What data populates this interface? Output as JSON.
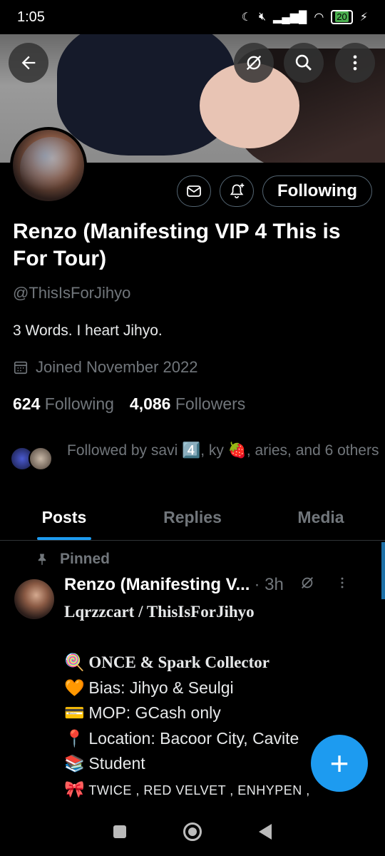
{
  "status_bar": {
    "time": "1:05",
    "battery": "20",
    "icons": [
      "moon-icon",
      "muted-icon",
      "signal-icon",
      "wifi-icon",
      "battery-icon",
      "charging-icon"
    ]
  },
  "header": {
    "back_icon": "back-arrow-icon",
    "grok_icon": "grok-icon",
    "search_icon": "search-icon",
    "more_icon": "more-vertical-icon"
  },
  "profile": {
    "display_name": "Renzo (Manifesting VIP 4 This is For Tour)",
    "handle": "@ThisIsForJihyo",
    "bio": "3 Words. I heart Jihyo.",
    "joined": "Joined November 2022",
    "following_count": "624",
    "following_label": "Following",
    "followers_count": "4,086",
    "followers_label": "Followers",
    "followed_by": "Followed by savi 4️⃣, ky 🍓, aries, and 6 others"
  },
  "actions": {
    "message_icon": "envelope-icon",
    "notify_icon": "bell-plus-icon",
    "following_button": "Following"
  },
  "tabs": [
    {
      "label": "Posts",
      "active": true
    },
    {
      "label": "Replies",
      "active": false
    },
    {
      "label": "Media",
      "active": false
    }
  ],
  "post": {
    "pinned_label": "Pinned",
    "author": "Renzo (Manifesting V...",
    "time": "· 3h",
    "lines": [
      {
        "emoji": "",
        "text": "Lqrzzcart / ThisIsForJihyo",
        "style": "serif"
      },
      {
        "emoji": "",
        "text": "",
        "style": "plain"
      },
      {
        "emoji": "🍭",
        "text": "ONCE & Spark Collector",
        "style": "serif"
      },
      {
        "emoji": "🧡",
        "text": "Bias: Jihyo & Seulgi",
        "style": "plain"
      },
      {
        "emoji": "💳",
        "text": "MOP: GCash only",
        "style": "plain"
      },
      {
        "emoji": "📍",
        "text": "Location: Bacoor City, Cavite",
        "style": "plain"
      },
      {
        "emoji": "📚",
        "text": "Student",
        "style": "plain"
      },
      {
        "emoji": "🎀",
        "text": "TWICE , RED VELVET , ENHYPEN ,",
        "style": "caps"
      }
    ]
  },
  "fab": {
    "label": "+"
  },
  "colors": {
    "accent": "#1d9bf0",
    "muted": "#71767b",
    "border": "#536471"
  }
}
